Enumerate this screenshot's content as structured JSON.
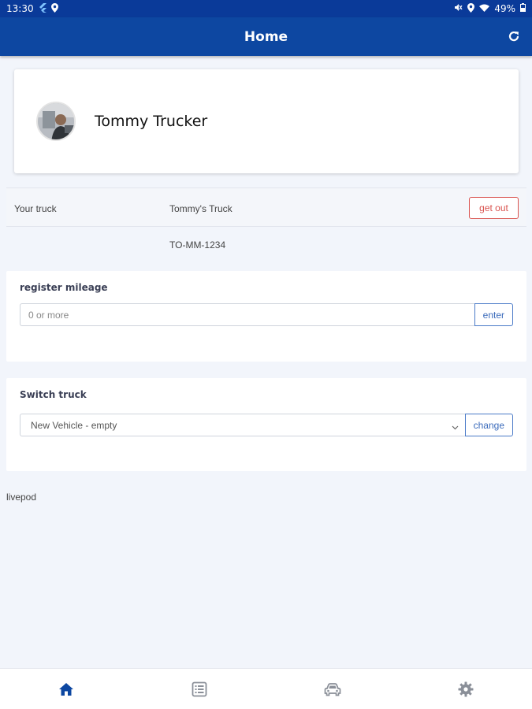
{
  "status_bar": {
    "time": "13:30",
    "battery": "49%",
    "icons_left": [
      "flutter-icon",
      "location-pin-icon"
    ],
    "icons_right": [
      "mute-icon",
      "location-pin-icon",
      "wifi-icon",
      "battery-icon"
    ]
  },
  "app_bar": {
    "title": "Home",
    "refresh_icon": "refresh-icon"
  },
  "profile": {
    "name": "Tommy Trucker",
    "avatar": "avatar-photo"
  },
  "truck": {
    "label": "Your truck",
    "name": "Tommy's Truck",
    "plate": "TO-MM-1234",
    "get_out_label": "get out"
  },
  "mileage": {
    "title": "register mileage",
    "placeholder": "0 or more",
    "button_label": "enter"
  },
  "switch_truck": {
    "title": "Switch truck",
    "selected": "New Vehicle - empty",
    "button_label": "change"
  },
  "footer": {
    "text": "livepod"
  },
  "bottom_nav": {
    "items": [
      "home-icon",
      "list-icon",
      "car-icon",
      "gear-icon"
    ],
    "active": "home-icon"
  },
  "colors": {
    "primary": "#0d47a1",
    "status_bar": "#0a3a99",
    "danger": "#d9534f",
    "button_outline": "#4a7ac8",
    "background": "#f2f5fb",
    "nav_inactive": "#8a8f98"
  }
}
